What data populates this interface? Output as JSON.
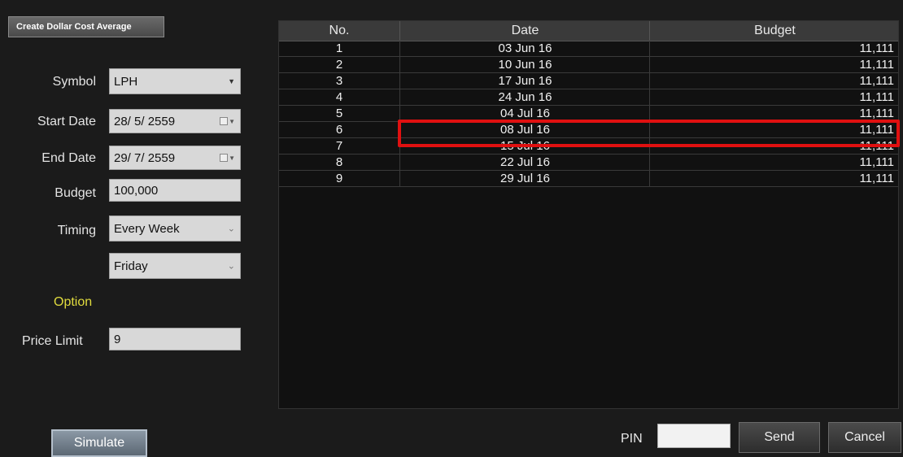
{
  "title_button": "Create Dollar Cost Average",
  "form": {
    "symbol_label": "Symbol",
    "symbol_value": "LPH",
    "start_date_label": "Start Date",
    "start_date_value": "28/ 5/ 2559",
    "end_date_label": "End Date",
    "end_date_value": "29/ 7/ 2559",
    "budget_label": "Budget",
    "budget_value": "100,000",
    "timing_label": "Timing",
    "timing_value": "Every Week",
    "day_value": "Friday",
    "option_label": "Option",
    "price_limit_label": "Price Limit",
    "price_limit_value": "9"
  },
  "simulate_button": "Simulate",
  "table": {
    "headers": [
      "No.",
      "Date",
      "Budget"
    ],
    "rows": [
      [
        "1",
        "03 Jun 16",
        "11,111"
      ],
      [
        "2",
        "10 Jun 16",
        "11,111"
      ],
      [
        "3",
        "17 Jun 16",
        "11,111"
      ],
      [
        "4",
        "24 Jun 16",
        "11,111"
      ],
      [
        "5",
        "04 Jul 16",
        "11,111"
      ],
      [
        "6",
        "08 Jul 16",
        "11,111"
      ],
      [
        "7",
        "15 Jul 16",
        "11,111"
      ],
      [
        "8",
        "22 Jul 16",
        "11,111"
      ],
      [
        "9",
        "29 Jul 16",
        "11,111"
      ]
    ],
    "highlighted_row": 5
  },
  "footer": {
    "pin_label": "PIN",
    "pin_value": "",
    "send_button": "Send",
    "cancel_button": "Cancel"
  },
  "colors": {
    "background": "#1b1b1b",
    "option_accent": "#e1dc3e",
    "highlight": "#e01010"
  },
  "icons": {
    "symbol_dropdown": "dropdown-arrow-icon",
    "date_picker": "calendar-icon",
    "select_chevron": "chevron-down-icon"
  }
}
